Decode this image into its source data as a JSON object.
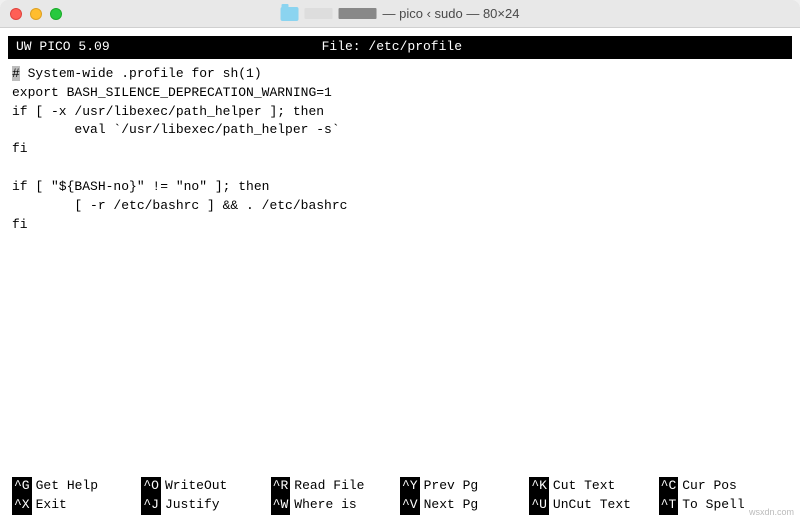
{
  "titlebar": {
    "title_suffix": "— pico ‹ sudo — 80×24"
  },
  "status": {
    "app": "UW PICO 5.09",
    "file_label": "File: /etc/profile"
  },
  "content": {
    "lines": [
      "# System-wide .profile for sh(1)",
      "export BASH_SILENCE_DEPRECATION_WARNING=1",
      "if [ -x /usr/libexec/path_helper ]; then",
      "        eval `/usr/libexec/path_helper -s`",
      "fi",
      "",
      "if [ \"${BASH-no}\" != \"no\" ]; then",
      "        [ -r /etc/bashrc ] && . /etc/bashrc",
      "fi"
    ]
  },
  "shortcuts": {
    "row1": [
      {
        "key": "^G",
        "label": "Get Help"
      },
      {
        "key": "^O",
        "label": "WriteOut"
      },
      {
        "key": "^R",
        "label": "Read File"
      },
      {
        "key": "^Y",
        "label": "Prev Pg"
      },
      {
        "key": "^K",
        "label": "Cut Text"
      },
      {
        "key": "^C",
        "label": "Cur Pos"
      }
    ],
    "row2": [
      {
        "key": "^X",
        "label": "Exit"
      },
      {
        "key": "^J",
        "label": "Justify"
      },
      {
        "key": "^W",
        "label": "Where is"
      },
      {
        "key": "^V",
        "label": "Next Pg"
      },
      {
        "key": "^U",
        "label": "UnCut Text"
      },
      {
        "key": "^T",
        "label": "To Spell"
      }
    ]
  },
  "watermark": "wsxdn.com"
}
